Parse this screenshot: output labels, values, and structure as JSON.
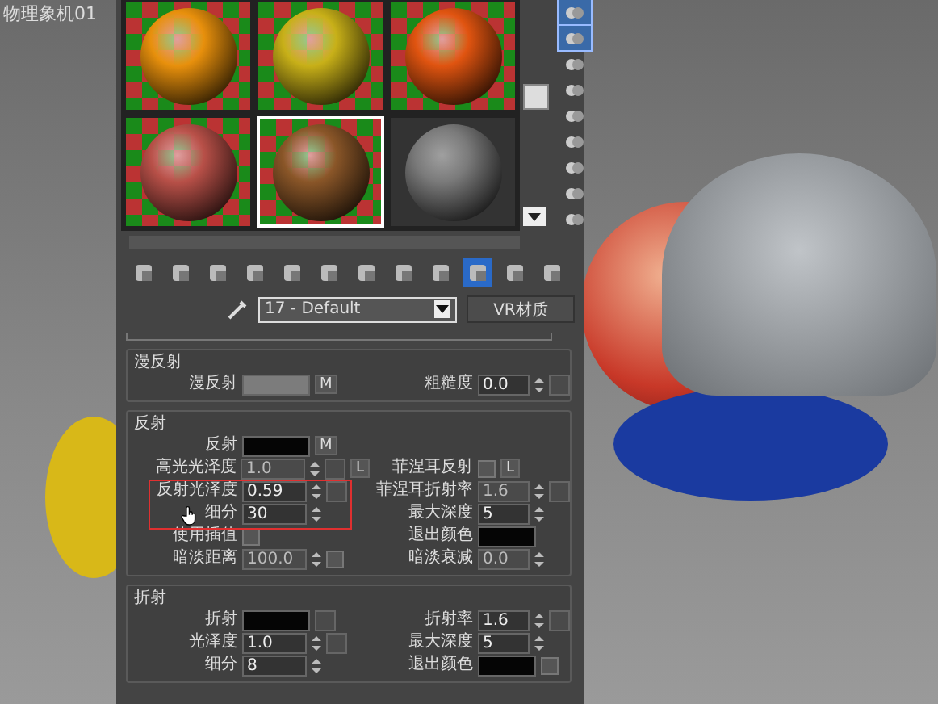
{
  "viewport": {
    "label": "物理象机01"
  },
  "sample_slots": [
    {
      "color": "#e8900c",
      "selected": false
    },
    {
      "color": "#c8b018",
      "selected": false
    },
    {
      "color": "#e05410",
      "selected": false
    },
    {
      "color": "#b85048",
      "selected": false
    },
    {
      "color": "#8a5628",
      "selected": true
    },
    {
      "color": "#7a7a7a",
      "selected": false
    }
  ],
  "side_tools": [
    {
      "selected": true
    },
    {
      "selected": true
    },
    {
      "selected": false
    },
    {
      "selected": false
    },
    {
      "selected": false
    },
    {
      "selected": false
    },
    {
      "selected": false
    },
    {
      "selected": false
    },
    {
      "selected": false
    }
  ],
  "toolbar": [
    {
      "selected": false
    },
    {
      "selected": false
    },
    {
      "selected": false
    },
    {
      "selected": false
    },
    {
      "selected": false
    },
    {
      "selected": false
    },
    {
      "selected": false
    },
    {
      "selected": false
    },
    {
      "selected": false
    },
    {
      "selected": true
    },
    {
      "selected": false
    },
    {
      "selected": false
    }
  ],
  "material": {
    "name": "17 - Default",
    "type_button": "VR材质"
  },
  "rollouts": [
    {
      "title": "漫反射",
      "rows": [
        {
          "left": {
            "kind": "color",
            "label": "漫反射",
            "color": "#7c7c7c",
            "map": "M"
          },
          "right": {
            "kind": "spinner",
            "label": "粗糙度",
            "value": "0.0",
            "disabled": false,
            "slot": true
          }
        }
      ]
    },
    {
      "title": "反射",
      "rows": [
        {
          "left": {
            "kind": "color",
            "label": "反射",
            "color": "#050505",
            "map": "M"
          }
        },
        {
          "left": {
            "kind": "spinner",
            "label": "高光光泽度",
            "value": "1.0",
            "disabled": true,
            "slot": true,
            "lock": "L"
          },
          "right": {
            "kind": "checkbox",
            "label": "菲涅耳反射",
            "checked": false,
            "lock": "L"
          }
        },
        {
          "left": {
            "kind": "spinner",
            "label": "反射光泽度",
            "value": "0.59",
            "disabled": false,
            "slot": true
          },
          "right": {
            "kind": "spinner",
            "label": "菲涅耳折射率",
            "value": "1.6",
            "disabled": true,
            "slot": true
          }
        },
        {
          "left": {
            "kind": "spinner",
            "label": "细分",
            "value": "30",
            "disabled": false
          },
          "right": {
            "kind": "spinner",
            "label": "最大深度",
            "value": "5",
            "disabled": false
          }
        },
        {
          "left": {
            "kind": "checkbox",
            "label": "使用插值",
            "checked": false
          },
          "right": {
            "kind": "color",
            "label": "退出颜色",
            "color": "#050505"
          }
        },
        {
          "left": {
            "kind": "spinner",
            "label": "暗淡距离",
            "value": "100.0",
            "disabled": true,
            "checked": false
          },
          "right": {
            "kind": "spinner",
            "label": "暗淡衰减",
            "value": "0.0",
            "disabled": true
          }
        }
      ]
    },
    {
      "title": "折射",
      "rows": [
        {
          "left": {
            "kind": "color",
            "label": "折射",
            "color": "#050505",
            "slot": true
          },
          "right": {
            "kind": "spinner",
            "label": "折射率",
            "value": "1.6",
            "disabled": false,
            "slot": true
          }
        },
        {
          "left": {
            "kind": "spinner",
            "label": "光泽度",
            "value": "1.0",
            "disabled": false,
            "slot": true
          },
          "right": {
            "kind": "spinner",
            "label": "最大深度",
            "value": "5",
            "disabled": false
          }
        },
        {
          "left": {
            "kind": "spinner",
            "label": "细分",
            "value": "8",
            "disabled": false
          },
          "right": {
            "kind": "color",
            "label": "退出颜色",
            "color": "#050505",
            "checked": false
          }
        }
      ]
    }
  ]
}
